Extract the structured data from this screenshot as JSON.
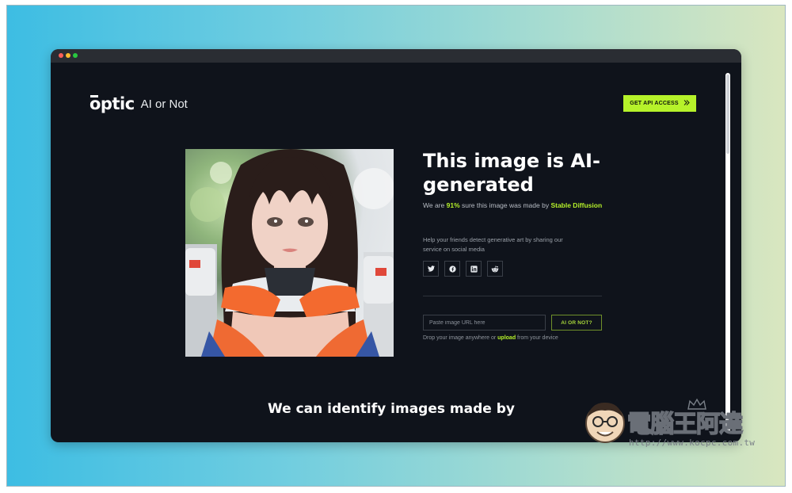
{
  "window": {
    "controls": [
      "close",
      "minimize",
      "maximize"
    ]
  },
  "brand": {
    "logo": "optic",
    "product": "AI or Not"
  },
  "header": {
    "api_button_label": "GET API ACCESS",
    "api_button_icon": "double-chevron-right-icon"
  },
  "result": {
    "headline": "This image is AI-generated",
    "line_prefix": "We are ",
    "confidence": "91%",
    "line_middle": " sure this image was made by ",
    "model": "Stable Diffusion",
    "share_text": "Help your friends detect generative art by sharing our service on social media"
  },
  "socials": [
    {
      "name": "twitter",
      "icon": "twitter-icon"
    },
    {
      "name": "facebook",
      "icon": "facebook-icon"
    },
    {
      "name": "linkedin",
      "icon": "linkedin-icon"
    },
    {
      "name": "reddit",
      "icon": "reddit-icon"
    }
  ],
  "checker": {
    "url_placeholder": "Paste image URL here",
    "url_value": "",
    "button_label": "AI OR NOT?",
    "drop_prefix": "Drop your image anywhere or ",
    "drop_link": "upload",
    "drop_suffix": " from your device"
  },
  "section": {
    "title": "We can identify images made by"
  },
  "watermark": {
    "title": "電腦王阿達",
    "url": "http://www.kocpc.com.tw"
  },
  "colors": {
    "accent": "#b6f22a",
    "page_bg": "#0f131b",
    "backdrop_left": "#3dbde3",
    "backdrop_right": "#d9e6bf"
  }
}
